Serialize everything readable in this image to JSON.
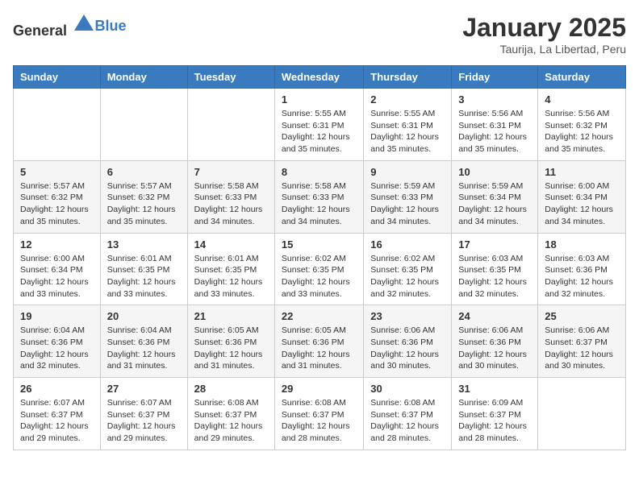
{
  "header": {
    "logo_general": "General",
    "logo_blue": "Blue",
    "title": "January 2025",
    "subtitle": "Taurija, La Libertad, Peru"
  },
  "days_of_week": [
    "Sunday",
    "Monday",
    "Tuesday",
    "Wednesday",
    "Thursday",
    "Friday",
    "Saturday"
  ],
  "weeks": [
    [
      {
        "day": "",
        "info": ""
      },
      {
        "day": "",
        "info": ""
      },
      {
        "day": "",
        "info": ""
      },
      {
        "day": "1",
        "info": "Sunrise: 5:55 AM\nSunset: 6:31 PM\nDaylight: 12 hours\nand 35 minutes."
      },
      {
        "day": "2",
        "info": "Sunrise: 5:55 AM\nSunset: 6:31 PM\nDaylight: 12 hours\nand 35 minutes."
      },
      {
        "day": "3",
        "info": "Sunrise: 5:56 AM\nSunset: 6:31 PM\nDaylight: 12 hours\nand 35 minutes."
      },
      {
        "day": "4",
        "info": "Sunrise: 5:56 AM\nSunset: 6:32 PM\nDaylight: 12 hours\nand 35 minutes."
      }
    ],
    [
      {
        "day": "5",
        "info": "Sunrise: 5:57 AM\nSunset: 6:32 PM\nDaylight: 12 hours\nand 35 minutes."
      },
      {
        "day": "6",
        "info": "Sunrise: 5:57 AM\nSunset: 6:32 PM\nDaylight: 12 hours\nand 35 minutes."
      },
      {
        "day": "7",
        "info": "Sunrise: 5:58 AM\nSunset: 6:33 PM\nDaylight: 12 hours\nand 34 minutes."
      },
      {
        "day": "8",
        "info": "Sunrise: 5:58 AM\nSunset: 6:33 PM\nDaylight: 12 hours\nand 34 minutes."
      },
      {
        "day": "9",
        "info": "Sunrise: 5:59 AM\nSunset: 6:33 PM\nDaylight: 12 hours\nand 34 minutes."
      },
      {
        "day": "10",
        "info": "Sunrise: 5:59 AM\nSunset: 6:34 PM\nDaylight: 12 hours\nand 34 minutes."
      },
      {
        "day": "11",
        "info": "Sunrise: 6:00 AM\nSunset: 6:34 PM\nDaylight: 12 hours\nand 34 minutes."
      }
    ],
    [
      {
        "day": "12",
        "info": "Sunrise: 6:00 AM\nSunset: 6:34 PM\nDaylight: 12 hours\nand 33 minutes."
      },
      {
        "day": "13",
        "info": "Sunrise: 6:01 AM\nSunset: 6:35 PM\nDaylight: 12 hours\nand 33 minutes."
      },
      {
        "day": "14",
        "info": "Sunrise: 6:01 AM\nSunset: 6:35 PM\nDaylight: 12 hours\nand 33 minutes."
      },
      {
        "day": "15",
        "info": "Sunrise: 6:02 AM\nSunset: 6:35 PM\nDaylight: 12 hours\nand 33 minutes."
      },
      {
        "day": "16",
        "info": "Sunrise: 6:02 AM\nSunset: 6:35 PM\nDaylight: 12 hours\nand 32 minutes."
      },
      {
        "day": "17",
        "info": "Sunrise: 6:03 AM\nSunset: 6:35 PM\nDaylight: 12 hours\nand 32 minutes."
      },
      {
        "day": "18",
        "info": "Sunrise: 6:03 AM\nSunset: 6:36 PM\nDaylight: 12 hours\nand 32 minutes."
      }
    ],
    [
      {
        "day": "19",
        "info": "Sunrise: 6:04 AM\nSunset: 6:36 PM\nDaylight: 12 hours\nand 32 minutes."
      },
      {
        "day": "20",
        "info": "Sunrise: 6:04 AM\nSunset: 6:36 PM\nDaylight: 12 hours\nand 31 minutes."
      },
      {
        "day": "21",
        "info": "Sunrise: 6:05 AM\nSunset: 6:36 PM\nDaylight: 12 hours\nand 31 minutes."
      },
      {
        "day": "22",
        "info": "Sunrise: 6:05 AM\nSunset: 6:36 PM\nDaylight: 12 hours\nand 31 minutes."
      },
      {
        "day": "23",
        "info": "Sunrise: 6:06 AM\nSunset: 6:36 PM\nDaylight: 12 hours\nand 30 minutes."
      },
      {
        "day": "24",
        "info": "Sunrise: 6:06 AM\nSunset: 6:36 PM\nDaylight: 12 hours\nand 30 minutes."
      },
      {
        "day": "25",
        "info": "Sunrise: 6:06 AM\nSunset: 6:37 PM\nDaylight: 12 hours\nand 30 minutes."
      }
    ],
    [
      {
        "day": "26",
        "info": "Sunrise: 6:07 AM\nSunset: 6:37 PM\nDaylight: 12 hours\nand 29 minutes."
      },
      {
        "day": "27",
        "info": "Sunrise: 6:07 AM\nSunset: 6:37 PM\nDaylight: 12 hours\nand 29 minutes."
      },
      {
        "day": "28",
        "info": "Sunrise: 6:08 AM\nSunset: 6:37 PM\nDaylight: 12 hours\nand 29 minutes."
      },
      {
        "day": "29",
        "info": "Sunrise: 6:08 AM\nSunset: 6:37 PM\nDaylight: 12 hours\nand 28 minutes."
      },
      {
        "day": "30",
        "info": "Sunrise: 6:08 AM\nSunset: 6:37 PM\nDaylight: 12 hours\nand 28 minutes."
      },
      {
        "day": "31",
        "info": "Sunrise: 6:09 AM\nSunset: 6:37 PM\nDaylight: 12 hours\nand 28 minutes."
      },
      {
        "day": "",
        "info": ""
      }
    ]
  ]
}
